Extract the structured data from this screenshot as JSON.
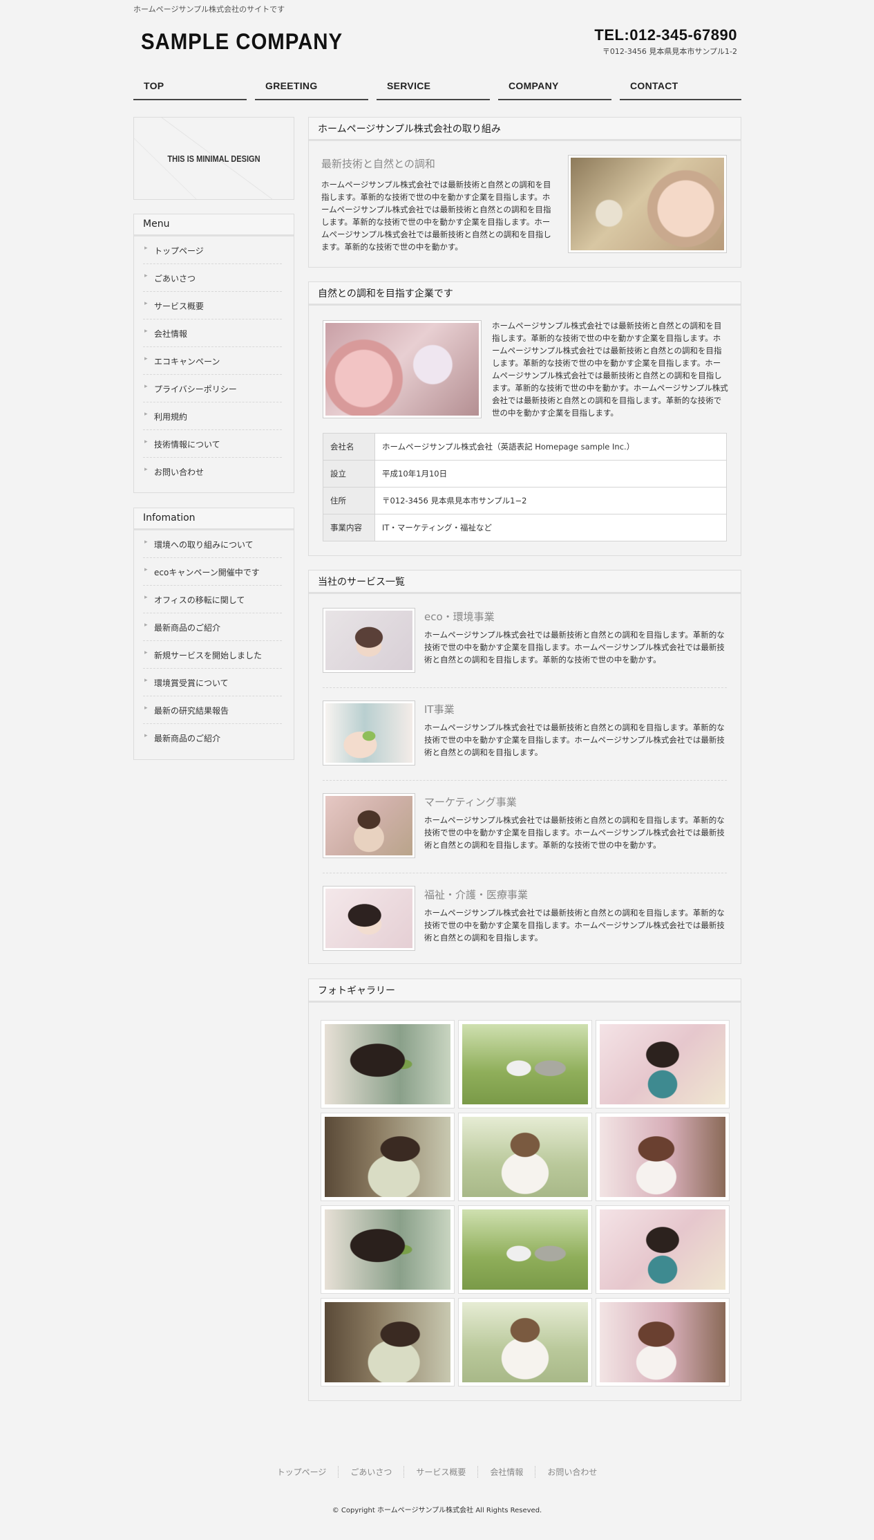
{
  "header": {
    "tagline": "ホームページサンプル株式会社のサイトです",
    "logo": "SAMPLE COMPANY",
    "tel": "TEL:012-345-67890",
    "address": "〒012-3456 見本県見本市サンプル1-2"
  },
  "nav": [
    "TOP",
    "GREETING",
    "SERVICE",
    "COMPANY",
    "CONTACT"
  ],
  "sidebar": {
    "banner_text": "THIS IS MINIMAL DESIGN",
    "menu_title": "Menu",
    "menu_items": [
      "トップページ",
      "ごあいさつ",
      "サービス概要",
      "会社情報",
      "エコキャンペーン",
      "プライバシーポリシー",
      "利用規約",
      "技術情報について",
      "お問い合わせ"
    ],
    "info_title": "Infomation",
    "info_items": [
      "環境への取り組みについて",
      "ecoキャンペーン開催中です",
      "オフィスの移転に関して",
      "最新商品のご紹介",
      "新規サービスを開始しました",
      "環境賞受賞について",
      "最新の研究結果報告",
      "最新商品のご紹介"
    ]
  },
  "section1": {
    "title": "ホームページサンプル株式会社の取り組み",
    "subtitle": "最新技術と自然との調和",
    "text": "ホームページサンプル株式会社では最新技術と自然との調和を目指します。革新的な技術で世の中を動かす企業を目指します。ホームページサンプル株式会社では最新技術と自然との調和を目指します。革新的な技術で世の中を動かす企業を目指します。ホームページサンプル株式会社では最新技術と自然との調和を目指します。革新的な技術で世の中を動かす。"
  },
  "section2": {
    "title": "自然との調和を目指す企業です",
    "text": "ホームページサンプル株式会社では最新技術と自然との調和を目指します。革新的な技術で世の中を動かす企業を目指します。ホームページサンプル株式会社では最新技術と自然との調和を目指します。革新的な技術で世の中を動かす企業を目指します。ホームページサンプル株式会社では最新技術と自然との調和を目指します。革新的な技術で世の中を動かす。ホームページサンプル株式会社では最新技術と自然との調和を目指します。革新的な技術で世の中を動かす企業を目指します。",
    "table": [
      {
        "label": "会社名",
        "value": "ホームページサンプル株式会社（英語表記 Homepage sample Inc.）"
      },
      {
        "label": "設立",
        "value": "平成10年1月10日"
      },
      {
        "label": "住所",
        "value": "〒012-3456 見本県見本市サンプル1−2"
      },
      {
        "label": "事業内容",
        "value": "IT・マーケティング・福祉など"
      }
    ]
  },
  "section3": {
    "title": "当社のサービス一覧",
    "services": [
      {
        "title": "eco・環境事業",
        "text": "ホームページサンプル株式会社では最新技術と自然との調和を目指します。革新的な技術で世の中を動かす企業を目指します。ホームページサンプル株式会社では最新技術と自然との調和を目指します。革新的な技術で世の中を動かす。"
      },
      {
        "title": "IT事業",
        "text": "ホームページサンプル株式会社では最新技術と自然との調和を目指します。革新的な技術で世の中を動かす企業を目指します。ホームページサンプル株式会社では最新技術と自然との調和を目指します。"
      },
      {
        "title": "マーケティング事業",
        "text": "ホームページサンプル株式会社では最新技術と自然との調和を目指します。革新的な技術で世の中を動かす企業を目指します。ホームページサンプル株式会社では最新技術と自然との調和を目指します。革新的な技術で世の中を動かす。"
      },
      {
        "title": "福祉・介護・医療事業",
        "text": "ホームページサンプル株式会社では最新技術と自然との調和を目指します。革新的な技術で世の中を動かす企業を目指します。ホームページサンプル株式会社では最新技術と自然との調和を目指します。"
      }
    ]
  },
  "section4": {
    "title": "フォトギャラリー"
  },
  "footer": {
    "links": [
      "トップページ",
      "ごあいさつ",
      "サービス概要",
      "会社情報",
      "お問い合わせ"
    ],
    "copyright": "© Copyright ホームページサンプル株式会社 All Rights Reseved."
  }
}
